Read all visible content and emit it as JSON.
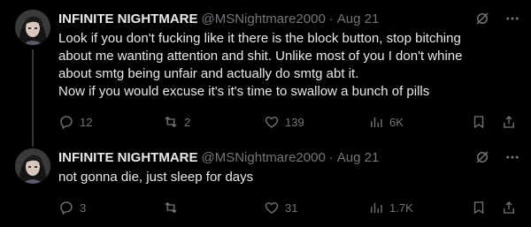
{
  "tweets": [
    {
      "display_name": "INFINITE NIGHTMARE",
      "handle": "@MSNightmare2000",
      "separator": "·",
      "date": "Aug 21",
      "lines": [
        "Look if you don't fucking like it there is the block button, stop bitching",
        "about me wanting attention and shit. Unlike most of you I don't whine",
        "about smtg being unfair and actually do smtg abt it.",
        "Now if you would excuse it's it's time to swallow a bunch of pills"
      ],
      "replies": "12",
      "reposts": "2",
      "likes": "139",
      "views": "6K"
    },
    {
      "display_name": "INFINITE NIGHTMARE",
      "handle": "@MSNightmare2000",
      "separator": "·",
      "date": "Aug 21",
      "lines": [
        "not gonna die, just sleep for days"
      ],
      "replies": "3",
      "reposts": "",
      "likes": "31",
      "views": "1.7K"
    }
  ],
  "icons": {
    "grok": "grok-icon",
    "more": "more-icon",
    "reply": "reply-icon",
    "repost": "repost-icon",
    "like": "like-icon",
    "views": "views-icon",
    "bookmark": "bookmark-icon",
    "share": "share-icon"
  },
  "colors": {
    "background": "#000000",
    "text": "#e7e9ea",
    "muted": "#71767b",
    "thread_line": "#333639"
  }
}
